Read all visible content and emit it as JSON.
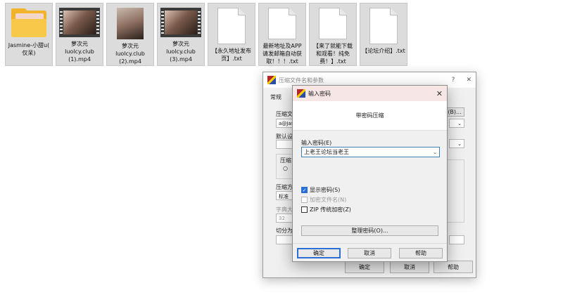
{
  "files": [
    {
      "name": "Jasmine-小甜u(\n仅呆)",
      "type": "folder"
    },
    {
      "name": "萝次元\nluolcy.club\n(1).mp4",
      "type": "video"
    },
    {
      "name": "萝次元\nluolcy.club\n(2).mp4",
      "type": "photo"
    },
    {
      "name": "萝次元\nluolcy.club\n(3).mp4",
      "type": "video"
    },
    {
      "name": "【永久地址发布\n页】.txt",
      "type": "txt"
    },
    {
      "name": "最新地址及APP\n请发邮箱自动获\n取！！！.txt",
      "type": "txt"
    },
    {
      "name": "【来了就能下载\n和观看！纯免\n费！】.txt",
      "type": "txt"
    },
    {
      "name": "【论坛介绍】.txt",
      "type": "txt"
    }
  ],
  "bg_dialog": {
    "title": "压缩文件名和参数",
    "help": "?",
    "close": "✕",
    "tab_general": "常规",
    "archive_name_label": "压缩文",
    "archive_name_value": "a@Jas",
    "browse_button": "(B)...",
    "default_settings_label": "默认设",
    "format_label": "压缩",
    "method_label": "压缩方",
    "method_value": "标准",
    "dict_label": "字典大",
    "dict_value": "32",
    "split_label": "切分为",
    "ok": "确定",
    "cancel": "取消",
    "help_button": "帮助"
  },
  "pw_dialog": {
    "title": "输入密码",
    "close": "✕",
    "header": "带密码压缩",
    "password_label": "输入密码(E)",
    "password_value": "上老王论坛当老王",
    "show_password": "显示密码(S)",
    "encrypt_names": "加密文件名(N)",
    "zip_legacy": "ZIP 传统加密(Z)",
    "organize": "整理密码(O)...",
    "ok": "确定",
    "cancel": "取消",
    "help": "帮助"
  },
  "colors": {
    "accent": "#2b6fd6",
    "folder": "#f2b32b",
    "tile": "#dcdcdc"
  }
}
